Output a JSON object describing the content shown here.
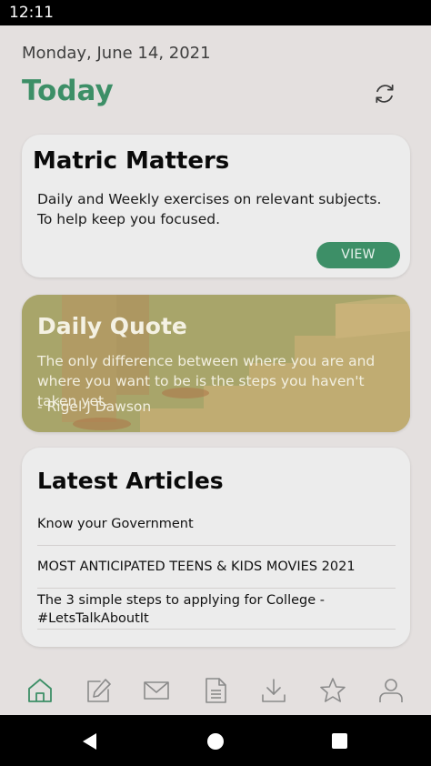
{
  "status_bar": {
    "time": "12:11"
  },
  "header": {
    "date": "Monday, June 14, 2021",
    "title": "Today",
    "refresh_icon": "refresh-icon"
  },
  "matric": {
    "title": "Matric Matters",
    "description": "Daily and Weekly exercises on relevant subjects. To help keep you focused.",
    "button_label": "VIEW"
  },
  "quote": {
    "title": "Daily Quote",
    "text": "The only difference between where you are and where you want to be is the steps you haven't taken yet.",
    "author": "- Rigel J Dawson"
  },
  "articles": {
    "title": "Latest Articles",
    "items": [
      "Know your Government",
      "MOST ANTICIPATED TEENS & KIDS MOVIES 2021",
      "The 3 simple steps to applying for College - #LetsTalkAboutIt"
    ]
  },
  "bottom_nav": {
    "items": [
      "home-icon",
      "edit-icon",
      "mail-icon",
      "document-icon",
      "download-icon",
      "star-icon",
      "profile-icon"
    ],
    "active": "home-icon"
  },
  "system_nav": [
    "back-icon",
    "home-circle-icon",
    "recents-icon"
  ],
  "colors": {
    "accent": "#3d8f67",
    "background": "#e4e0df",
    "card": "#ececec",
    "quote_card": "#a8a56a"
  }
}
